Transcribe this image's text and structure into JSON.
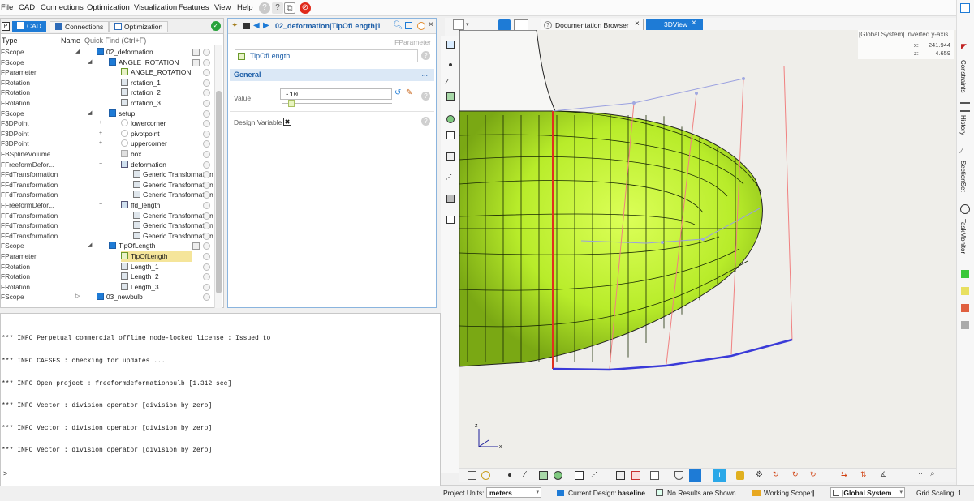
{
  "menu": {
    "items": [
      "File",
      "CAD",
      "Connections",
      "Optimization",
      "Visualization",
      "Features",
      "View",
      "Help"
    ]
  },
  "left_tabs": {
    "cad": "CAD",
    "connections": "Connections",
    "optimization": "Optimization"
  },
  "tree": {
    "col_type": "Type",
    "col_name": "Name",
    "quick_find": "Quick Find (Ctrl+F)",
    "rows": [
      {
        "type": "FScope",
        "name": "02_deformation",
        "icon": "folder",
        "indent": 1,
        "exp": "open"
      },
      {
        "type": "FScope",
        "name": "ANGLE_ROTATION",
        "icon": "folder",
        "indent": 2,
        "exp": "open"
      },
      {
        "type": "FParameter",
        "name": "ANGLE_ROTATION",
        "icon": "param",
        "indent": 3,
        "exp": ""
      },
      {
        "type": "FRotation",
        "name": "rotation_1",
        "icon": "transform",
        "indent": 3,
        "exp": ""
      },
      {
        "type": "FRotation",
        "name": "rotation_2",
        "icon": "transform",
        "indent": 3,
        "exp": ""
      },
      {
        "type": "FRotation",
        "name": "rotation_3",
        "icon": "transform",
        "indent": 3,
        "exp": ""
      },
      {
        "type": "FScope",
        "name": "setup",
        "icon": "folder",
        "indent": 2,
        "exp": "open"
      },
      {
        "type": "F3DPoint",
        "name": "lowercorner",
        "icon": "point",
        "indent": 3,
        "exp": "+"
      },
      {
        "type": "F3DPoint",
        "name": "pivotpoint",
        "icon": "point",
        "indent": 3,
        "exp": "+"
      },
      {
        "type": "F3DPoint",
        "name": "uppercorner",
        "icon": "point",
        "indent": 3,
        "exp": "+"
      },
      {
        "type": "FBSplineVolume",
        "name": "box",
        "icon": "box",
        "indent": 3,
        "exp": ""
      },
      {
        "type": "FFreeformDefor...",
        "name": "deformation",
        "icon": "ffd",
        "indent": 3,
        "exp": "-"
      },
      {
        "type": "FFdTransformation",
        "name": "Generic Transformation",
        "icon": "transform",
        "indent": 4,
        "exp": ""
      },
      {
        "type": "FFdTransformation",
        "name": "Generic Transformation",
        "icon": "transform",
        "indent": 4,
        "exp": ""
      },
      {
        "type": "FFdTransformation",
        "name": "Generic Transformation",
        "icon": "transform",
        "indent": 4,
        "exp": ""
      },
      {
        "type": "FFreeformDefor...",
        "name": "ffd_length",
        "icon": "ffd",
        "indent": 3,
        "exp": "-"
      },
      {
        "type": "FFdTransformation",
        "name": "Generic Transformation",
        "icon": "transform",
        "indent": 4,
        "exp": ""
      },
      {
        "type": "FFdTransformation",
        "name": "Generic Transformation",
        "icon": "transform",
        "indent": 4,
        "exp": ""
      },
      {
        "type": "FFdTransformation",
        "name": "Generic Transformation",
        "icon": "transform",
        "indent": 4,
        "exp": ""
      },
      {
        "type": "FScope",
        "name": "TipOfLength",
        "icon": "folder",
        "indent": 2,
        "exp": "open"
      },
      {
        "type": "FParameter",
        "name": "TipOfLength",
        "icon": "param",
        "indent": 3,
        "exp": "",
        "selected": true
      },
      {
        "type": "FRotation",
        "name": "Length_1",
        "icon": "transform",
        "indent": 3,
        "exp": ""
      },
      {
        "type": "FRotation",
        "name": "Length_2",
        "icon": "transform",
        "indent": 3,
        "exp": ""
      },
      {
        "type": "FRotation",
        "name": "Length_3",
        "icon": "transform",
        "indent": 3,
        "exp": ""
      },
      {
        "type": "FScope",
        "name": "03_newbulb",
        "icon": "folder",
        "indent": 1,
        "exp": "closed"
      }
    ]
  },
  "console": {
    "lines": [
      "*** INFO Perpetual commercial offline node-locked license : Issued to",
      "*** INFO CAESES : checking for updates ...",
      "*** INFO Open project : freeformdeformationbulb [1.312 sec]",
      "*** INFO Vector : division operator [division by zero]",
      "*** INFO Vector : division operator [division by zero]",
      "*** INFO Vector : division operator [division by zero]"
    ],
    "prompt": ">"
  },
  "properties": {
    "title": "02_deformation|TipOfLength|1",
    "type_label": "FParameter",
    "object_name": "TipOfLength",
    "section": "General",
    "section_more": "...",
    "value_label": "Value",
    "value": "-10",
    "slider_fraction": 0.06,
    "design_variable_label": "Design Variable",
    "design_variable_mark": "✖"
  },
  "view_tabs": {
    "doc_browser": "Documentation Browser",
    "view3d": "3DView",
    "close": "×"
  },
  "viewport": {
    "coord_system": "[Global System] inverted y-axis",
    "x_label": "x:",
    "x_value": "241.944",
    "z_label": "z:",
    "z_value": "4.659",
    "axis_z": "z",
    "axis_x": "x",
    "colors": {
      "hull": "#c6f23a",
      "hull_dark": "#5f8a10",
      "bg": "#efeeea",
      "red": "#e03020",
      "blue": "#3a3ad8"
    }
  },
  "right_tabs": [
    "Constraints",
    "History",
    "SectionSet",
    "TaskMonitor"
  ],
  "status": {
    "units_label": "Project Units:",
    "units_value": "meters",
    "design_label": "Current Design:",
    "design_value": "baseline",
    "results": "No Results are Shown",
    "scope_label": "Working Scope:",
    "scope_value": "|",
    "system_value": "|Global System",
    "grid_label": "Grid Scaling:",
    "grid_value": "1"
  }
}
